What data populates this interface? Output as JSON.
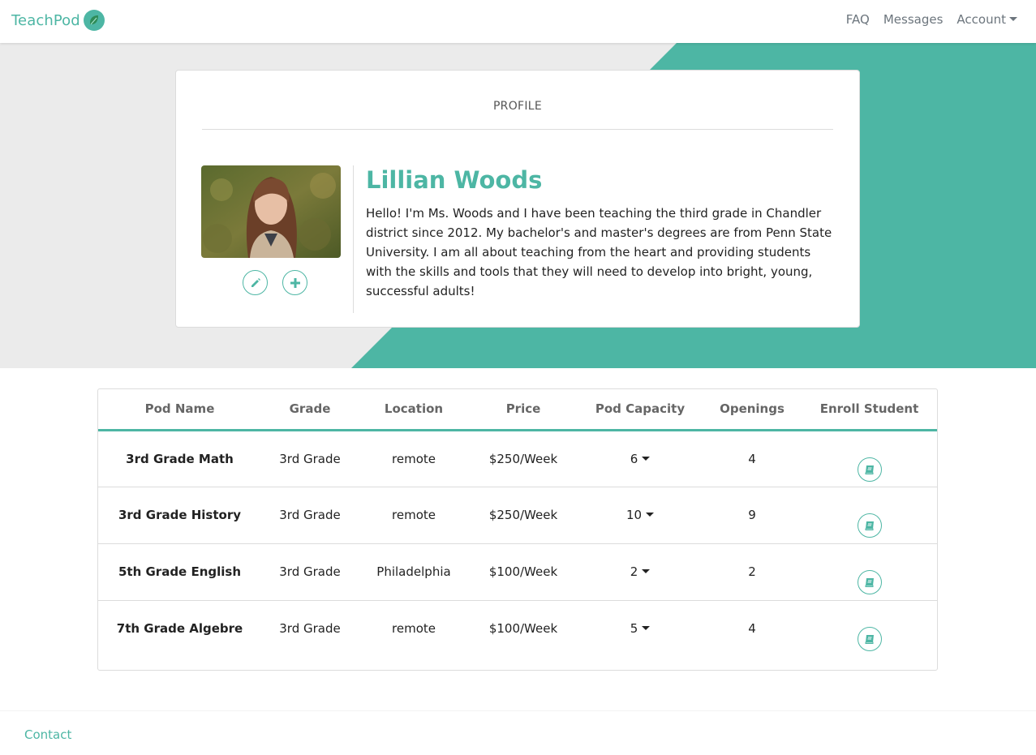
{
  "brand": {
    "name": "TeachPod"
  },
  "nav": {
    "faq": "FAQ",
    "messages": "Messages",
    "account": "Account"
  },
  "colors": {
    "accent": "#4db6a4",
    "hero_bg": "#ebebeb"
  },
  "profile": {
    "section_title": "PROFILE",
    "name": "Lillian Woods",
    "bio": "Hello! I'm Ms. Woods and I have been teaching the third grade in Chandler district since 2012. My bachelor's and master's degrees are from Penn State University. I am all about teaching from the heart and providing students with the skills and tools that they will need to develop into bright, young, successful adults!",
    "actions": [
      "pencil-icon",
      "plus-icon"
    ]
  },
  "table": {
    "headers": [
      "Pod Name",
      "Grade",
      "Location",
      "Price",
      "Pod Capacity",
      "Openings",
      "Enroll Student"
    ],
    "rows": [
      {
        "pod_name": "3rd Grade Math",
        "grade": "3rd Grade",
        "location": "remote",
        "price": "$250/Week",
        "capacity": "6",
        "openings": "4"
      },
      {
        "pod_name": "3rd Grade History",
        "grade": "3rd Grade",
        "location": "remote",
        "price": "$250/Week",
        "capacity": "10",
        "openings": "9"
      },
      {
        "pod_name": "5th Grade English",
        "grade": "3rd Grade",
        "location": "Philadelphia",
        "price": "$100/Week",
        "capacity": "2",
        "openings": "2"
      },
      {
        "pod_name": "7th Grade Algebre",
        "grade": "3rd Grade",
        "location": "remote",
        "price": "$100/Week",
        "capacity": "5",
        "openings": "4"
      }
    ],
    "enroll_icon": "book-icon"
  },
  "footer": {
    "contact": "Contact"
  }
}
